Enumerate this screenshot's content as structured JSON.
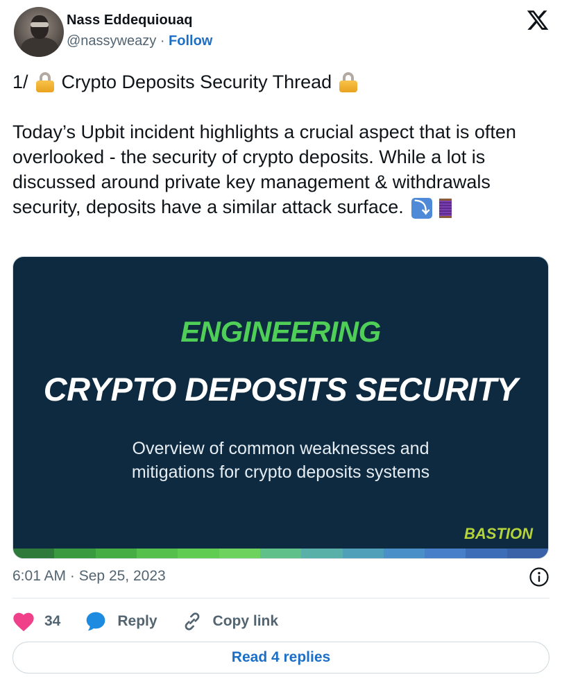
{
  "author": {
    "name": "Nass Eddequiouaq",
    "handle": "@nassyweazy",
    "separator": "·",
    "follow_label": "Follow"
  },
  "tweet": {
    "line1": "1/",
    "title": "Crypto Deposits Security Thread",
    "body": "Today’s Upbit incident highlights a crucial aspect that is often overlooked - the security of crypto deposits. While a lot is discussed around private key management & withdrawals security, deposits have a similar attack surface.",
    "icons": [
      "lock-icon",
      "arrow-right-hook-down-icon",
      "thread-spool-icon"
    ]
  },
  "card": {
    "kicker": "ENGINEERING",
    "title": "CRYPTO DEPOSITS SECURITY",
    "subtitle_line1": "Overview of common weaknesses and",
    "subtitle_line2": "mitigations for crypto deposits systems",
    "brand": "BASTION",
    "colors": {
      "background": "#0e2a41",
      "kicker": "#4fcf58",
      "brand": "#b5d33b"
    },
    "stripe_colors": [
      "#2d7a3a",
      "#3a9a40",
      "#46ad45",
      "#55c04c",
      "#60cc52",
      "#6dd35e",
      "#5fc08a",
      "#58b0a8",
      "#4fa0b8",
      "#4a8fc8",
      "#4780c8",
      "#3e6db8",
      "#3a62a8"
    ]
  },
  "meta": {
    "time": "6:01 AM",
    "separator": "·",
    "date": "Sep 25, 2023"
  },
  "actions": {
    "likes": "34",
    "reply_label": "Reply",
    "copy_link_label": "Copy link"
  },
  "read_replies_label": "Read 4 replies",
  "colors": {
    "link_blue": "#1d6fc5",
    "heart": "#f0408a",
    "reply_bubble": "#1d8ce0",
    "muted": "#536471"
  }
}
